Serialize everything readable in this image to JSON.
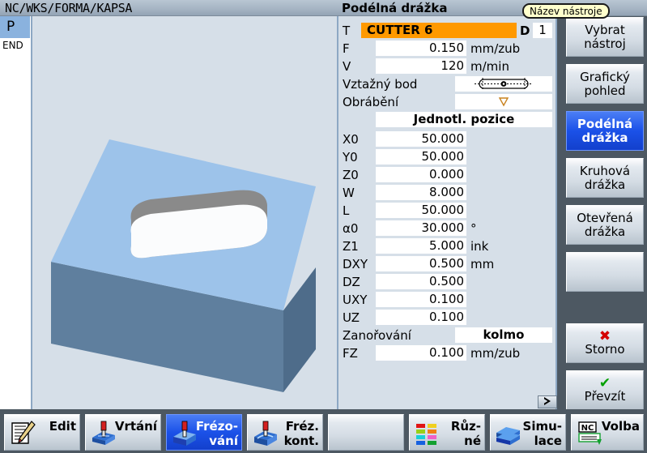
{
  "titlebar": {
    "path": "NC/WKS/FORMA/KAPSA",
    "screen_title": "Podélná drážka"
  },
  "channel": {
    "tab_p": "P",
    "tab_end": "END"
  },
  "tooltip": {
    "text": "Název nástroje"
  },
  "form": {
    "tool_label": "T",
    "tool_value": "CUTTER 6",
    "d_label": "D",
    "d_value": "1",
    "rows": [
      {
        "label": "F",
        "value": "0.150",
        "unit": "mm/zub"
      },
      {
        "label": "V",
        "value": "120",
        "unit": "m/min"
      }
    ],
    "reference_point_label": "Vztažný bod",
    "reference_point_icon": "slot-center-icon",
    "machining_label": "Obrábění",
    "machining_icon": "roughing-triangle-icon",
    "position_mode": "Jednotl. pozice",
    "geometry": [
      {
        "label": "X0",
        "value": "50.000",
        "unit": ""
      },
      {
        "label": "Y0",
        "value": "50.000",
        "unit": ""
      },
      {
        "label": "Z0",
        "value": "0.000",
        "unit": ""
      },
      {
        "label": "W",
        "value": "8.000",
        "unit": ""
      },
      {
        "label": "L",
        "value": "50.000",
        "unit": ""
      },
      {
        "label": "α0",
        "value": "30.000",
        "unit": "°"
      },
      {
        "label": "Z1",
        "value": "5.000",
        "unit": "ink"
      },
      {
        "label": "DXY",
        "value": "0.500",
        "unit": "mm"
      },
      {
        "label": "DZ",
        "value": "0.500",
        "unit": ""
      },
      {
        "label": "UXY",
        "value": "0.100",
        "unit": ""
      },
      {
        "label": "UZ",
        "value": "0.100",
        "unit": ""
      }
    ],
    "plunge_label": "Zanořování",
    "plunge_value": "kolmo",
    "fz_label": "FZ",
    "fz_value": "0.100",
    "fz_unit": "mm/zub",
    "scroll_arrow": "›"
  },
  "vertical_softkeys": [
    {
      "line1": "Vybrat",
      "line2": "nástroj",
      "selected": false,
      "icon": ""
    },
    {
      "line1": "Grafický",
      "line2": "pohled",
      "selected": false,
      "icon": ""
    },
    {
      "line1": "Podélná",
      "line2": "drážka",
      "selected": true,
      "icon": ""
    },
    {
      "line1": "Kruhová",
      "line2": "drážka",
      "selected": false,
      "icon": ""
    },
    {
      "line1": "Otevřená",
      "line2": "drážka",
      "selected": false,
      "icon": ""
    },
    {
      "line1": "",
      "line2": "",
      "selected": false,
      "icon": ""
    },
    {
      "line1": "Storno",
      "line2": "",
      "selected": false,
      "icon": "x"
    },
    {
      "line1": "Převzít",
      "line2": "",
      "selected": false,
      "icon": "v"
    }
  ],
  "horizontal_softkeys": [
    {
      "line1": "Edit",
      "line2": "",
      "selected": false,
      "icon": "edit-icon"
    },
    {
      "line1": "Vrtání",
      "line2": "",
      "selected": false,
      "icon": "drilling-icon"
    },
    {
      "line1": "Frézo-",
      "line2": "vání",
      "selected": true,
      "icon": "milling-icon"
    },
    {
      "line1": "Fréz.",
      "line2": "kont.",
      "selected": false,
      "icon": "contour-milling-icon"
    },
    {
      "line1": "",
      "line2": "",
      "selected": false,
      "icon": ""
    },
    {
      "line1": "Růz-",
      "line2": "né",
      "selected": false,
      "icon": "various-icon"
    },
    {
      "line1": "Simu-",
      "line2": "lace",
      "selected": false,
      "icon": "simulation-icon"
    },
    {
      "line1": "Volba",
      "line2": "",
      "selected": false,
      "icon": "nc-select-icon"
    }
  ],
  "graphic": {
    "name": "workpiece-3d-longitudinal-slot",
    "top_face_color": "#9dc3ea",
    "front_face_color": "#5f7f9e",
    "side_face_color": "#4e6c8a",
    "slot_wall_color": "#8a8a8a",
    "slot_floor_color": "#ffffff",
    "background_color": "#d6dfe8"
  },
  "colors": {
    "accent_blue": "#1b51e8",
    "tool_field_orange": "#ff9900",
    "tooltip_yellow": "#ffffcc",
    "panel_bg": "#d6dfe8",
    "softkey_bg": "#4d5862",
    "titlebar": "#a6b5c4"
  }
}
